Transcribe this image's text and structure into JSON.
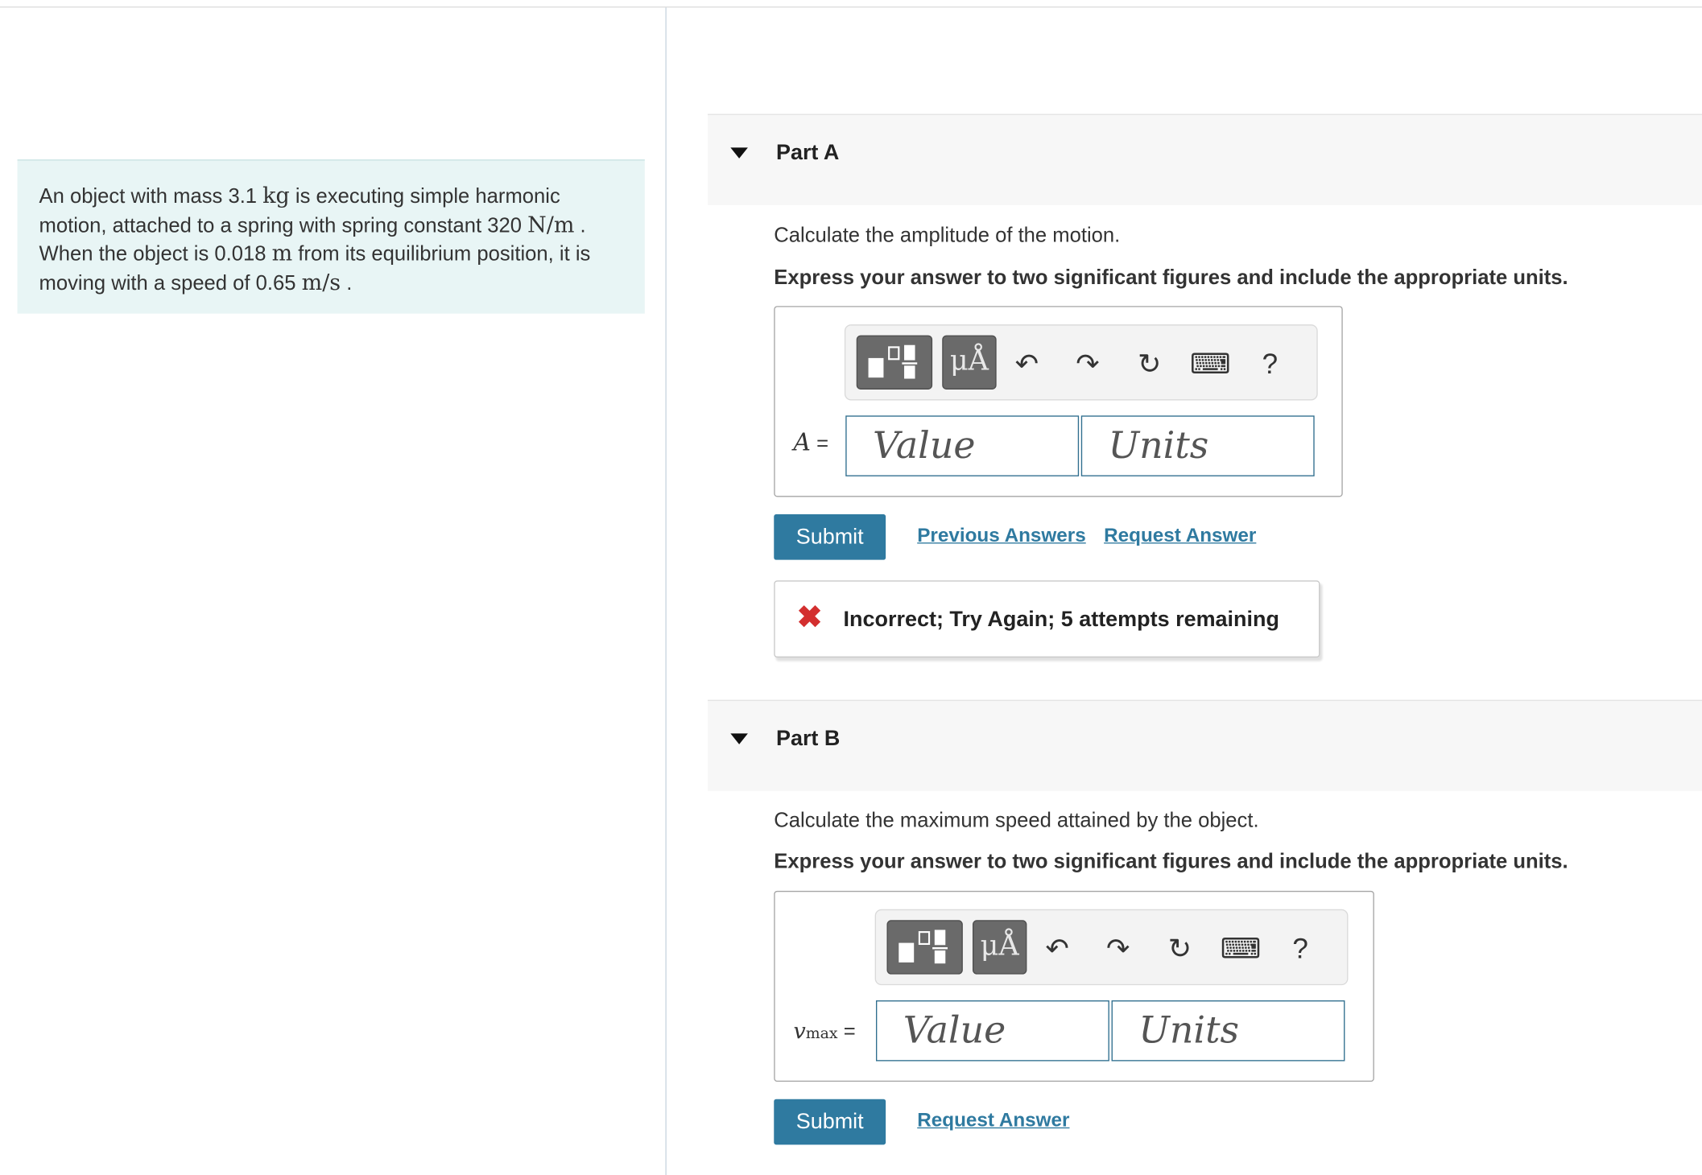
{
  "problem": {
    "t1": "An object with mass 3.1 ",
    "u_kg": "kg",
    "t2": " is executing simple harmonic motion, attached to a spring with spring constant 320 ",
    "u_Nm": "N/m",
    "t3": " . When the object is 0.018 ",
    "u_m": "m",
    "t4": " from its equilibrium position, it is moving with a speed of 0.65 ",
    "u_ms": "m/s",
    "t5": " ."
  },
  "toolbar": {
    "symbols": "μÅ",
    "undo": "↶",
    "redo": "↷",
    "reset": "↻",
    "keyboard": "⌨",
    "help": "?"
  },
  "icons": {
    "templates": "templates-icon",
    "symbols": "mu-angstrom-icon",
    "undo": "undo-icon",
    "redo": "redo-icon",
    "reset": "reset-icon",
    "keyboard": "keyboard-icon",
    "help": "help-icon",
    "error": "x-mark-icon",
    "caret": "caret-down-icon"
  },
  "colors": {
    "accent": "#2f7aa0",
    "error": "#d32f2f",
    "problem_bg": "#e8f5f5"
  },
  "partA": {
    "title": "Part A",
    "prompt": "Calculate the amplitude of the motion.",
    "instruction": "Express your answer to two significant figures and include the appropriate units.",
    "var": "A",
    "eq": " =",
    "value_placeholder": "Value",
    "units_placeholder": "Units",
    "submit": "Submit",
    "previous_answers": "Previous Answers",
    "request_answer": "Request Answer",
    "feedback_mark": "✖",
    "feedback": "Incorrect; Try Again; 5 attempts remaining"
  },
  "partB": {
    "title": "Part B",
    "prompt": "Calculate the maximum speed attained by the object.",
    "instruction": "Express your answer to two significant figures and include the appropriate units.",
    "var": "v",
    "var_sub": "max",
    "eq": " =",
    "value_placeholder": "Value",
    "units_placeholder": "Units",
    "submit": "Submit",
    "request_answer": "Request Answer"
  }
}
